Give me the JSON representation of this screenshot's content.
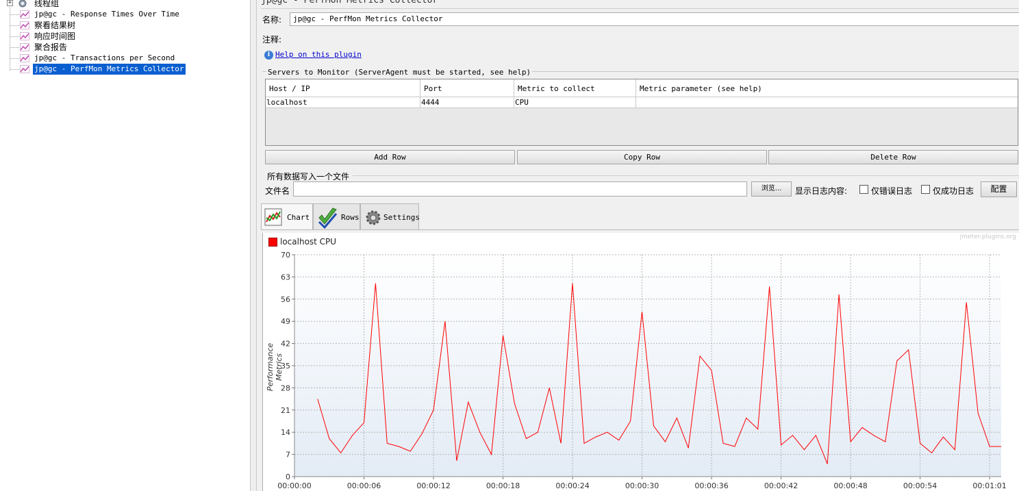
{
  "tree": {
    "items": [
      {
        "label": "线程组",
        "cn": true,
        "kind": "root"
      },
      {
        "label": "jp@gc - Response Times Over Time",
        "cn": false
      },
      {
        "label": "察看结果树",
        "cn": true
      },
      {
        "label": "响应时间图",
        "cn": true
      },
      {
        "label": "聚合报告",
        "cn": true
      },
      {
        "label": "jp@gc - Transactions per Second",
        "cn": false
      },
      {
        "label": "jp@gc - PerfMon Metrics Collector",
        "cn": false,
        "selected": true
      }
    ]
  },
  "panel": {
    "title": "jp@gc - PerfMon Metrics Collector",
    "name_label": "名称:",
    "name_value": "jp@gc - PerfMon Metrics Collector",
    "comment_label": "注释:",
    "help_link": "Help on this plugin",
    "servers_legend": "Servers to Monitor (ServerAgent must be started, see help)",
    "table": {
      "headers": [
        "Host / IP",
        "Port",
        "Metric to collect",
        "Metric parameter (see help)"
      ],
      "rows": [
        [
          "localhost",
          "4444",
          "CPU",
          ""
        ]
      ]
    },
    "buttons": {
      "add": "Add Row",
      "copy": "Copy Row",
      "delete": "Delete Row"
    },
    "file_legend": "所有数据写入一个文件",
    "file_label": "文件名",
    "browse": "浏览...",
    "log_label": "显示日志内容:",
    "errors_only": "仅错误日志",
    "success_only": "仅成功日志",
    "config": "配置",
    "tabs": {
      "chart": "Chart",
      "rows": "Rows",
      "settings": "Settings"
    }
  },
  "chart_data": {
    "type": "line",
    "watermark": "jmeter-plugins.org",
    "ylabel": "Performance Metrics",
    "xlabel": "",
    "ylim": [
      0,
      70
    ],
    "yticks": [
      0,
      7,
      14,
      21,
      28,
      35,
      42,
      49,
      56,
      63,
      70
    ],
    "xlim": [
      0,
      61
    ],
    "xticks": [
      0,
      6,
      12,
      18,
      24,
      30,
      36,
      42,
      48,
      54,
      60
    ],
    "xtick_labels": [
      "00:00:00",
      "00:00:06",
      "00:00:12",
      "00:00:18",
      "00:00:24",
      "00:00:30",
      "00:00:36",
      "00:00:42",
      "00:00:48",
      "00:00:54",
      "00:01:01"
    ],
    "grid": true,
    "legend_position": "top-left",
    "series": [
      {
        "name": "localhost CPU",
        "color": "#ff0000",
        "x": [
          2,
          3,
          4,
          5,
          6,
          7,
          8,
          9,
          10,
          11,
          12,
          13,
          14,
          15,
          16,
          17,
          18,
          19,
          20,
          21,
          22,
          23,
          24,
          25,
          26,
          27,
          28,
          29,
          30,
          31,
          32,
          33,
          34,
          35,
          36,
          37,
          38,
          39,
          40,
          41,
          42,
          43,
          44,
          45,
          46,
          47,
          48,
          49,
          50,
          51,
          52,
          53,
          54,
          55,
          56,
          57,
          58,
          59,
          60,
          61
        ],
        "values": [
          24.5,
          12,
          7.5,
          13,
          17,
          61,
          10.5,
          9.5,
          8,
          13.5,
          21,
          49,
          5,
          23.5,
          14,
          7,
          44.5,
          23,
          12,
          14,
          28,
          10.5,
          61,
          10.5,
          12.5,
          14,
          11.5,
          17.5,
          52,
          16,
          11,
          18.5,
          9,
          38,
          33.5,
          10.5,
          9.5,
          18.5,
          15,
          60,
          10,
          13,
          8.5,
          13,
          4,
          57.5,
          11,
          15.5,
          13,
          11,
          36.5,
          40,
          10.5,
          7.5,
          12.5,
          8.5,
          55,
          20,
          9.5,
          9.5
        ]
      }
    ]
  }
}
